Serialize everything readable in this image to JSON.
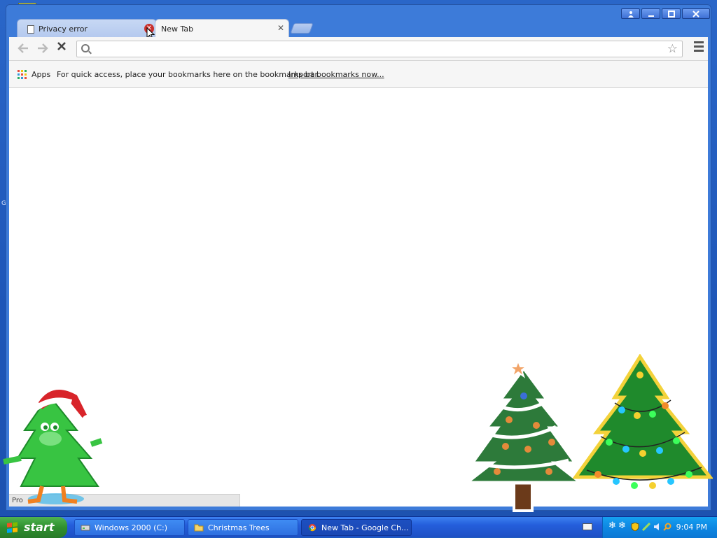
{
  "browser": {
    "tabs": [
      {
        "title": "Privacy error",
        "active": false
      },
      {
        "title": "New Tab",
        "active": true
      }
    ],
    "window_controls": [
      "user",
      "minimize",
      "maximize",
      "close"
    ],
    "bookmarks_bar": {
      "apps_label": "Apps",
      "message": "For quick access, place your bookmarks here on the bookmarks bar.",
      "import_link": "Import bookmarks now..."
    },
    "status_text": "Pro"
  },
  "desktop": {
    "side_letter": "G"
  },
  "taskbar": {
    "start_label": "start",
    "buttons": [
      {
        "label": "Windows 2000 (C:)",
        "active": false
      },
      {
        "label": "Christmas Trees",
        "active": false
      },
      {
        "label": "New Tab - Google Ch...",
        "active": true
      }
    ],
    "clock": "9:04 PM"
  },
  "colors": {
    "desktop": "#1f5cbd",
    "taskbar": "#245edb",
    "start_button": "#2f8f2f",
    "tray": "#0d87e2"
  }
}
